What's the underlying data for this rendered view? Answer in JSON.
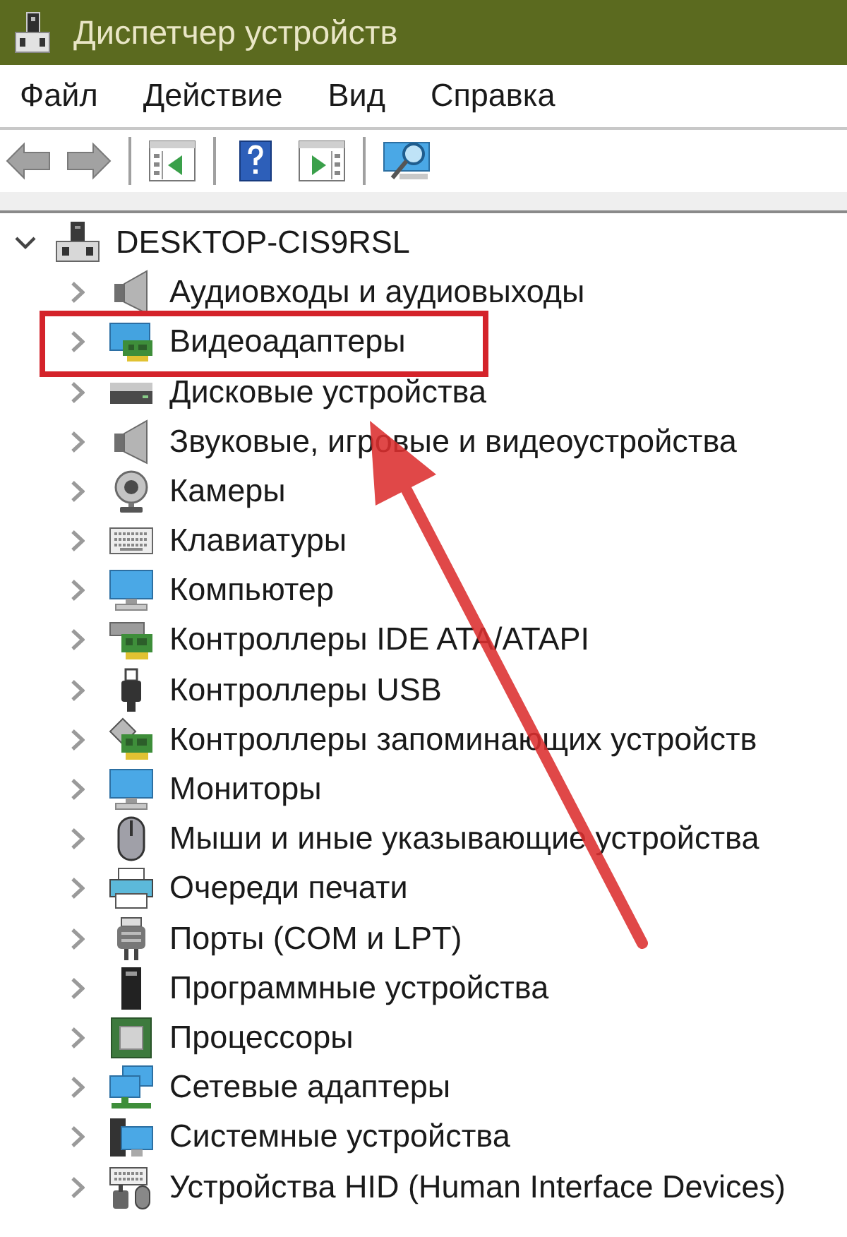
{
  "window": {
    "title": "Диспетчер устройств"
  },
  "menu": [
    "Файл",
    "Действие",
    "Вид",
    "Справка"
  ],
  "tree": {
    "label": "DESKTOP-CIS9RSL",
    "kind": "host",
    "expanded": true,
    "children": [
      {
        "label": "Аудиовходы и аудиовыходы",
        "kind": "speaker",
        "expanded": false,
        "highlighted": false
      },
      {
        "label": "Видеоадаптеры",
        "kind": "graphics",
        "expanded": false,
        "highlighted": true
      },
      {
        "label": "Дисковые устройства",
        "kind": "drive",
        "expanded": false,
        "highlighted": false
      },
      {
        "label": "Звуковые, игровые и видеоустройства",
        "kind": "speaker",
        "expanded": false,
        "highlighted": false
      },
      {
        "label": "Камеры",
        "kind": "webcam",
        "expanded": false,
        "highlighted": false
      },
      {
        "label": "Клавиатуры",
        "kind": "keyboard",
        "expanded": false,
        "highlighted": false
      },
      {
        "label": "Компьютер",
        "kind": "monitor",
        "expanded": false,
        "highlighted": false
      },
      {
        "label": "Контроллеры IDE ATA/ATAPI",
        "kind": "ide",
        "expanded": false,
        "highlighted": false
      },
      {
        "label": "Контроллеры USB",
        "kind": "usb",
        "expanded": false,
        "highlighted": false
      },
      {
        "label": "Контроллеры запоминающих устройств",
        "kind": "storage",
        "expanded": false,
        "highlighted": false
      },
      {
        "label": "Мониторы",
        "kind": "monitor",
        "expanded": false,
        "highlighted": false
      },
      {
        "label": "Мыши и иные указывающие устройства",
        "kind": "mouse",
        "expanded": false,
        "highlighted": false
      },
      {
        "label": "Очереди печати",
        "kind": "printer",
        "expanded": false,
        "highlighted": false
      },
      {
        "label": "Порты (COM и LPT)",
        "kind": "port",
        "expanded": false,
        "highlighted": false
      },
      {
        "label": "Программные устройства",
        "kind": "software",
        "expanded": false,
        "highlighted": false
      },
      {
        "label": "Процессоры",
        "kind": "cpu",
        "expanded": false,
        "highlighted": false
      },
      {
        "label": "Сетевые адаптеры",
        "kind": "network",
        "expanded": false,
        "highlighted": false
      },
      {
        "label": "Системные устройства",
        "kind": "system",
        "expanded": false,
        "highlighted": false
      },
      {
        "label": "Устройства HID (Human Interface Devices)",
        "kind": "hid",
        "expanded": false,
        "highlighted": false
      }
    ]
  }
}
